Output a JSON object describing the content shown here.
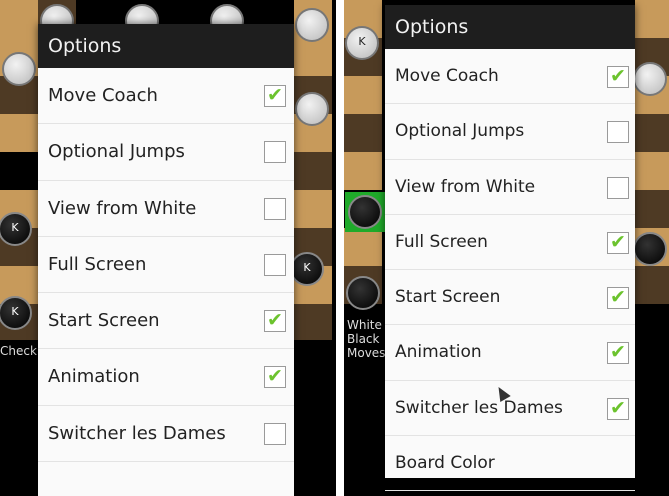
{
  "left": {
    "dialog_title": "Options",
    "options": [
      {
        "label": "Move Coach",
        "checked": true
      },
      {
        "label": "Optional Jumps",
        "checked": false
      },
      {
        "label": "View from White",
        "checked": false
      },
      {
        "label": "Full Screen",
        "checked": false
      },
      {
        "label": "Start Screen",
        "checked": true
      },
      {
        "label": "Animation",
        "checked": true
      },
      {
        "label": "Switcher les Dames",
        "checked": false
      }
    ],
    "status_text": "Check",
    "king_label": "K"
  },
  "right": {
    "dialog_title": "Options",
    "options": [
      {
        "label": "Move Coach",
        "checked": true
      },
      {
        "label": "Optional Jumps",
        "checked": false
      },
      {
        "label": "View from White",
        "checked": false
      },
      {
        "label": "Full Screen",
        "checked": true
      },
      {
        "label": "Start Screen",
        "checked": true
      },
      {
        "label": "Animation",
        "checked": true
      },
      {
        "label": "Switcher les Dames",
        "checked": true
      },
      {
        "label": "Board Color",
        "checked": null
      }
    ],
    "status_lines": [
      "White",
      "Black",
      "Moves"
    ],
    "king_label": "K",
    "highlight_color": "#1faa2a"
  },
  "icons": {
    "checkmark": "✔",
    "cursor": "mouse-pointer-icon"
  }
}
